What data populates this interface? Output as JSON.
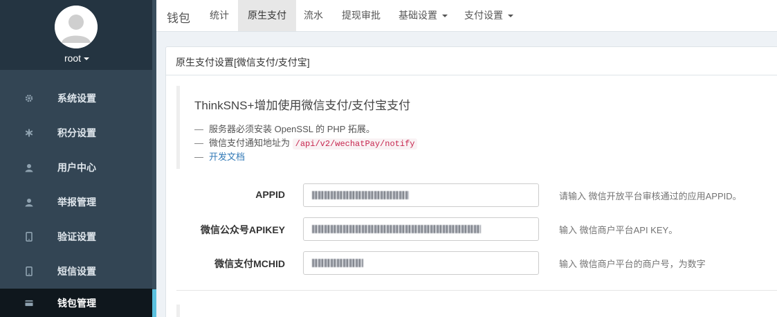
{
  "sidebar": {
    "user": {
      "name": "root"
    },
    "items": [
      {
        "label": "系统设置",
        "icon": "gear-icon"
      },
      {
        "label": "积分设置",
        "icon": "asterisk-icon"
      },
      {
        "label": "用户中心",
        "icon": "user-icon"
      },
      {
        "label": "举报管理",
        "icon": "user-icon"
      },
      {
        "label": "验证设置",
        "icon": "phone-icon"
      },
      {
        "label": "短信设置",
        "icon": "phone-icon"
      },
      {
        "label": "钱包管理",
        "icon": "card-icon",
        "active": true
      }
    ]
  },
  "topnav": {
    "brand": "钱包",
    "items": [
      {
        "label": "统计"
      },
      {
        "label": "原生支付",
        "active": true
      },
      {
        "label": "流水"
      },
      {
        "label": "提现审批"
      },
      {
        "label": "基础设置",
        "dropdown": true
      },
      {
        "label": "支付设置",
        "dropdown": true
      }
    ]
  },
  "panel": {
    "heading": "原生支付设置[微信支付/支付宝]",
    "callout": {
      "title": "ThinkSNS+增加使用微信支付/支付宝支付",
      "lines": [
        {
          "dash": "—",
          "text": "服务器必须安装 OpenSSL 的 PHP 拓展。"
        },
        {
          "dash": "—",
          "text": "微信支付通知地址为",
          "code": "/api/v2/wechatPay/notify"
        },
        {
          "dash": "—",
          "link": "开发文档"
        }
      ]
    },
    "form": {
      "fields": [
        {
          "label": "APPID",
          "help": "请输入 微信开放平台审核通过的应用APPID。"
        },
        {
          "label": "微信公众号APIKEY",
          "help": "输入 微信商户平台API KEY。"
        },
        {
          "label": "微信支付MCHID",
          "help": "输入 微信商户平台的商户号，为数字"
        }
      ]
    }
  },
  "colors": {
    "sidebar_bg": "#334554",
    "sidebar_top_bg": "#243441",
    "active_item_bg": "#0f171d",
    "accent": "#5bc0de",
    "link": "#337ab7",
    "code": "#c7254e"
  }
}
